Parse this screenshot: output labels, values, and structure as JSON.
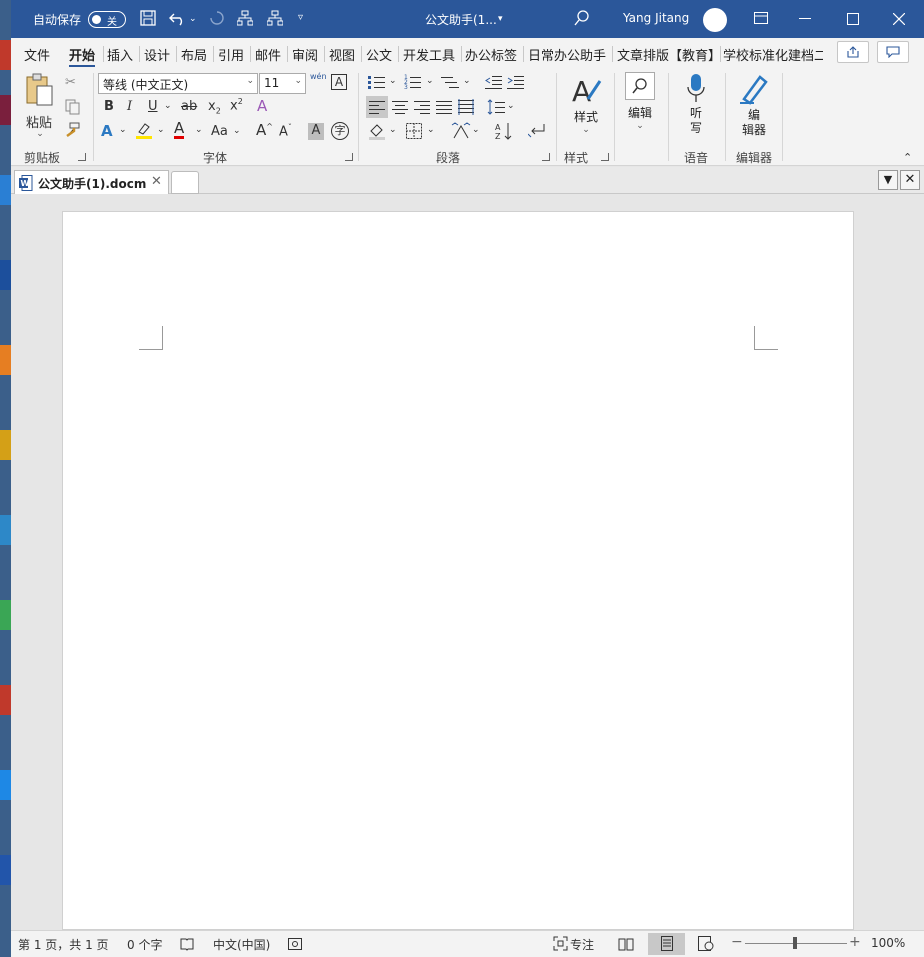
{
  "titlebar": {
    "autosave_label": "自动保存",
    "autosave_state": "关",
    "doc_title": "公文助手(1...",
    "user_name": "Yang Jitang",
    "icons": [
      "save-icon",
      "undo-icon",
      "redo-icon",
      "org-chart-icon",
      "org-chart-2-icon",
      "customize-qat-icon",
      "search-icon",
      "ribbon-display-icon",
      "minimize-icon",
      "maximize-icon",
      "close-icon"
    ]
  },
  "tabs": [
    "文件",
    "开始",
    "插入",
    "设计",
    "布局",
    "引用",
    "邮件",
    "审阅",
    "视图",
    "公文",
    "开发工具",
    "办公标签",
    "日常办公助手",
    "文章排版【教育】",
    "学校标准化建档二"
  ],
  "ribbon": {
    "clipboard": {
      "paste_label": "粘贴",
      "group_label": "剪贴板"
    },
    "font": {
      "font_name": "等线 (中文正文)",
      "font_size": "11",
      "group_label": "字体",
      "aa_label": "Aa",
      "phonetic": "wén"
    },
    "paragraph": {
      "group_label": "段落"
    },
    "styles": {
      "label": "样式",
      "group_label": "样式"
    },
    "editing": {
      "label": "编辑"
    },
    "voice": {
      "label_1": "听",
      "label_2": "写",
      "group_label": "语音"
    },
    "editor": {
      "label_1": "编",
      "label_2": "辑器",
      "group_label": "编辑器"
    }
  },
  "doctabs": {
    "active": "公文助手(1).docm"
  },
  "statusbar": {
    "page_info": "第 1 页，共 1 页",
    "word_count": "0 个字",
    "language": "中文(中国)",
    "focus": "专注",
    "zoom": "100%",
    "zoom_minus": "−",
    "zoom_plus": "+"
  }
}
